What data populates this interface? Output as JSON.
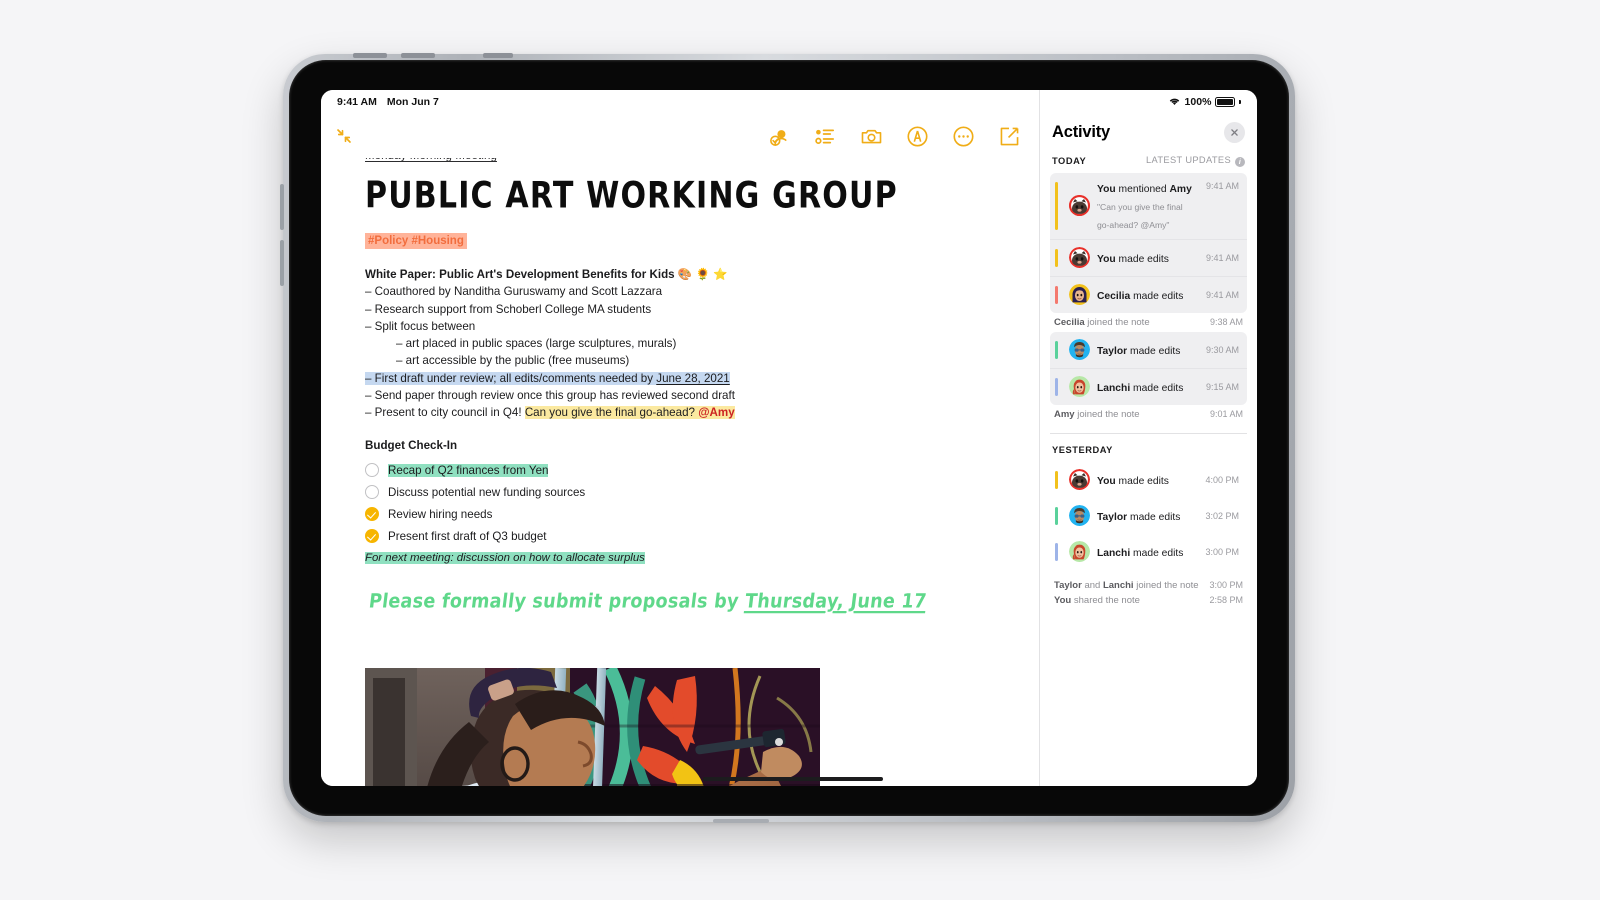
{
  "status_bar": {
    "time": "9:41 AM",
    "date": "Mon Jun 7",
    "battery_percent": "100%",
    "wifi_icon": "wifi-icon",
    "battery_icon": "battery-full-icon"
  },
  "toolbar": {
    "expand_icon": "collapse-arrows-icon",
    "items": [
      {
        "name": "add-people-icon",
        "label": "Add People"
      },
      {
        "name": "checklist-icon",
        "label": "Checklist"
      },
      {
        "name": "camera-icon",
        "label": "Camera"
      },
      {
        "name": "markup-pencil-icon",
        "label": "Markup"
      },
      {
        "name": "more-options-icon",
        "label": "More"
      },
      {
        "name": "compose-note-icon",
        "label": "New Note"
      }
    ]
  },
  "note": {
    "subtitle": "Monday Morning Meeting",
    "title": "PUBLIC ART WORKING GROUP",
    "tags": "#Policy #Housing",
    "whitepaper_heading": "White Paper: Public Art's Development Benefits for Kids",
    "whitepaper_emoji": "🎨 🌻 ⭐",
    "bullets": [
      {
        "text": "– Coauthored by Nanditha Guruswamy and Scott Lazzara",
        "indent": false,
        "highlight": "none"
      },
      {
        "text": "– Research support from Schoberl College MA students",
        "indent": false,
        "highlight": "none"
      },
      {
        "text": "– Split focus between",
        "indent": false,
        "highlight": "none"
      },
      {
        "text": "– art placed in public spaces (large sculptures, murals)",
        "indent": true,
        "highlight": "none"
      },
      {
        "text": "– art accessible by the public (free museums)",
        "indent": true,
        "highlight": "none"
      }
    ],
    "review_line_prefix": "– First draft under review; all edits/comments needed by ",
    "review_line_date": "June 28, 2021",
    "send_line": "– Send paper through review once this group has reviewed second draft",
    "council_line_prefix": "– Present to city council in Q4! ",
    "council_line_comment": "Can you give the final go-ahead? ",
    "council_line_mention": "@Amy",
    "budget_heading": "Budget Check-In",
    "todos": [
      {
        "label": "Recap of Q2 finances from Yen",
        "checked": false,
        "highlight": "green"
      },
      {
        "label": "Discuss potential new funding sources",
        "checked": false,
        "highlight": "none"
      },
      {
        "label": "Review hiring needs",
        "checked": true,
        "highlight": "none"
      },
      {
        "label": "Present first draft of Q3 budget",
        "checked": true,
        "highlight": "none"
      }
    ],
    "next_meeting_note": "For next meeting: discussion on how to allocate surplus",
    "handwriting_prefix": "Please formally submit proposals by ",
    "handwriting_underlined": "Thursday, June 17",
    "photo_alt": "Artist painting a colorful floral mural on a wall"
  },
  "activity": {
    "title": "Activity",
    "close_icon": "close-icon",
    "today_label": "TODAY",
    "latest_updates_label": "LATEST UPDATES",
    "info_icon": "info-icon",
    "today_events": [
      {
        "actor": "You",
        "action": " mentioned ",
        "target": "Amy",
        "quote": "\"Can you give the final go-ahead? @Amy\"",
        "time": "9:41 AM",
        "bar_color": "#f2c11c",
        "avatar_ring": "#e8302a",
        "avatar_name": "avatar-you",
        "highlighted": true
      },
      {
        "actor": "You",
        "action": " made edits",
        "target": "",
        "quote": "",
        "time": "9:41 AM",
        "bar_color": "#f2c11c",
        "avatar_ring": "#e8302a",
        "avatar_name": "avatar-you",
        "highlighted": true
      },
      {
        "actor": "Cecilia",
        "action": " made edits",
        "target": "",
        "quote": "",
        "time": "9:41 AM",
        "bar_color": "#f4796e",
        "avatar_ring": "#f2c11c",
        "avatar_name": "avatar-cecilia",
        "highlighted": true
      }
    ],
    "today_plain_1": {
      "actor": "Cecilia",
      "text": " joined the note",
      "time": "9:38 AM"
    },
    "today_events_2": [
      {
        "actor": "Taylor",
        "action": " made edits",
        "target": "",
        "quote": "",
        "time": "9:30 AM",
        "bar_color": "#5ad19b",
        "avatar_ring": "#22b3f0",
        "avatar_name": "avatar-taylor",
        "highlighted": true
      },
      {
        "actor": "Lanchi",
        "action": " made edits",
        "target": "",
        "quote": "",
        "time": "9:15 AM",
        "bar_color": "#9eb4e8",
        "avatar_ring": "#b7e8a8",
        "avatar_name": "avatar-lanchi",
        "highlighted": true
      }
    ],
    "today_plain_2": {
      "actor": "Amy",
      "text": " joined the note",
      "time": "9:01 AM"
    },
    "yesterday_label": "YESTERDAY",
    "yesterday_events": [
      {
        "actor": "You",
        "action": " made edits",
        "time": "4:00 PM",
        "bar_color": "#f2c11c",
        "avatar_ring": "#e8302a",
        "avatar_name": "avatar-you"
      },
      {
        "actor": "Taylor",
        "action": " made edits",
        "time": "3:02 PM",
        "bar_color": "#5ad19b",
        "avatar_ring": "#22b3f0",
        "avatar_name": "avatar-taylor"
      },
      {
        "actor": "Lanchi",
        "action": " made edits",
        "time": "3:00 PM",
        "bar_color": "#9eb4e8",
        "avatar_ring": "#b7e8a8",
        "avatar_name": "avatar-lanchi"
      }
    ],
    "yesterday_plain": [
      {
        "actor": "Taylor",
        "conj": " and ",
        "actor2": "Lanchi",
        "text": " joined the note",
        "time": "3:00 PM"
      },
      {
        "actor": "You",
        "conj": "",
        "actor2": "",
        "text": " shared the note",
        "time": "2:58 PM"
      }
    ]
  },
  "colors": {
    "accent_yellow": "#f0ad17",
    "tag_bg": "#ffb399",
    "tag_fg": "#f26d3d",
    "highlight_blue": "#c5d8f0",
    "highlight_yellow": "#fbe9a0",
    "highlight_green": "#8fe0c0",
    "mention_red": "#cc2222",
    "handwriting_green": "#5fd88a",
    "checkbox_on": "#f7b500"
  }
}
